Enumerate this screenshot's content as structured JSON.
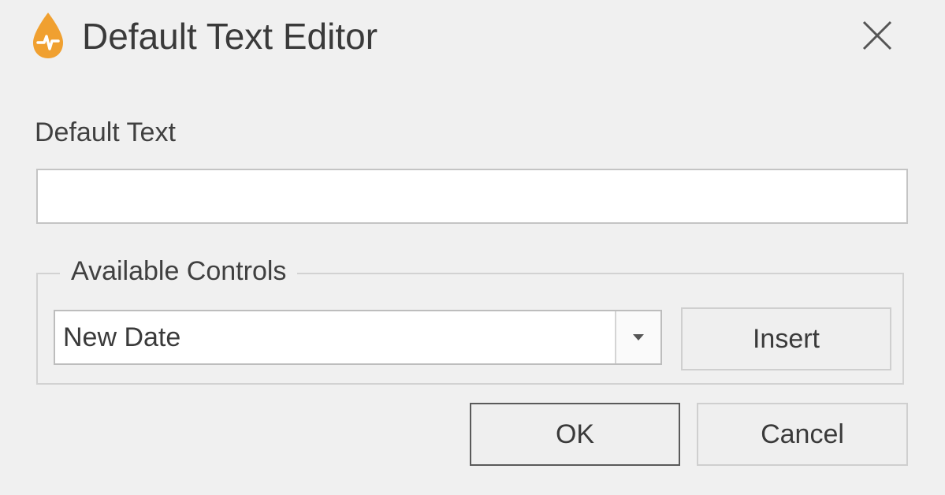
{
  "window": {
    "title": "Default Text Editor",
    "icon": "flame-droplet-icon",
    "accent_color": "#f0a030"
  },
  "form": {
    "default_text_label": "Default Text",
    "default_text_value": "",
    "group_label": "Available Controls",
    "control_selected": "New Date",
    "insert_label": "Insert"
  },
  "footer": {
    "ok_label": "OK",
    "cancel_label": "Cancel"
  }
}
